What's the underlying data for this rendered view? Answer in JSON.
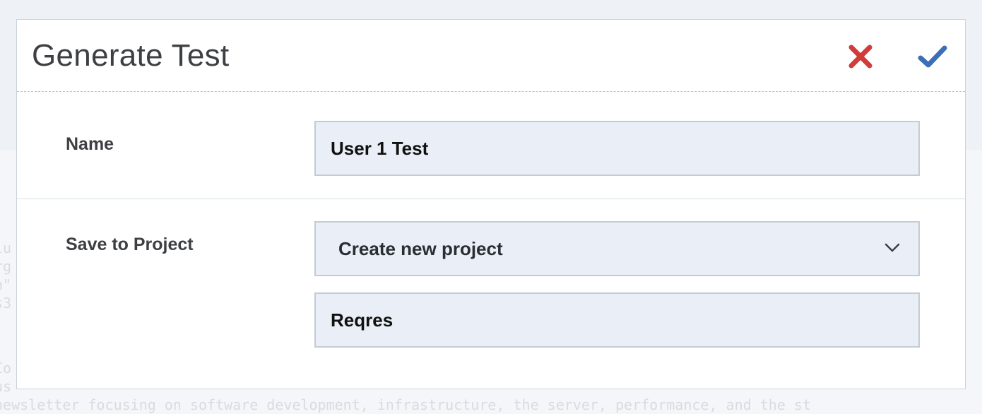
{
  "dialog": {
    "title": "Generate Test",
    "cancel_icon": "close-x-icon",
    "confirm_icon": "checkmark-icon",
    "colors": {
      "cancel": "#d33a3a",
      "confirm": "#3b6fb6"
    }
  },
  "form": {
    "name": {
      "label": "Name",
      "value": "User 1 Test"
    },
    "project": {
      "label": "Save to Project",
      "selected_option": "Create new project",
      "new_project_name": "Reqres"
    }
  }
}
